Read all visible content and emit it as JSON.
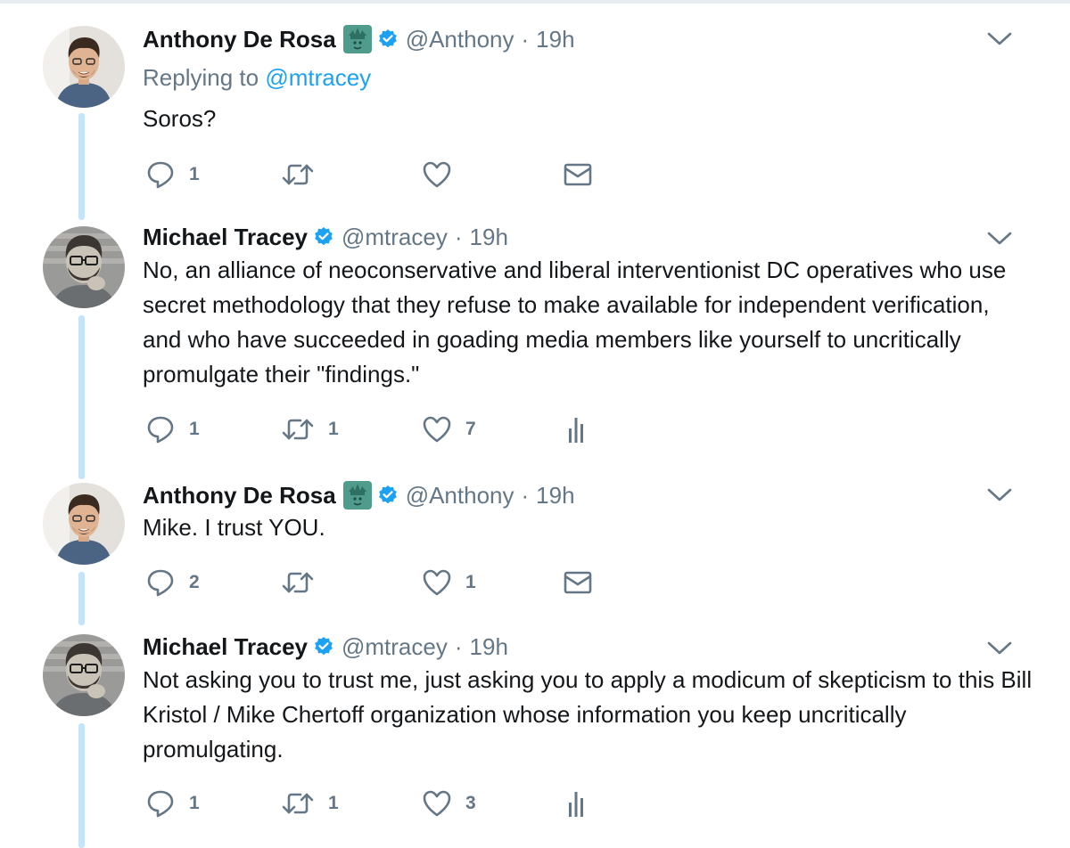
{
  "colors": {
    "accent": "#1da1f2",
    "muted": "#657786",
    "text": "#14171a",
    "thread": "#c4e4f9"
  },
  "tweets": [
    {
      "name": "Anthony De Rosa",
      "emoji": "statue-of-liberty",
      "verified": true,
      "handle": "@Anthony",
      "separator": "·",
      "time": "19h",
      "reply_prefix": "Replying to",
      "reply_mention": "@mtracey",
      "text": "Soros?",
      "replies": "1",
      "retweets": "",
      "likes": "",
      "extra_icon": "envelope-icon"
    },
    {
      "name": "Michael Tracey",
      "verified": true,
      "handle": "@mtracey",
      "separator": "·",
      "time": "19h",
      "text": "No, an alliance of neoconservative and liberal interventionist DC operatives who use secret methodology that they refuse to make available for independent verification, and who have succeeded in goading media members like yourself to uncritically promulgate their \"findings.\"",
      "replies": "1",
      "retweets": "1",
      "likes": "7",
      "extra_icon": "analytics-icon"
    },
    {
      "name": "Anthony De Rosa",
      "emoji": "statue-of-liberty",
      "verified": true,
      "handle": "@Anthony",
      "separator": "·",
      "time": "19h",
      "text": "Mike. I trust YOU.",
      "replies": "2",
      "retweets": "",
      "likes": "1",
      "extra_icon": "envelope-icon"
    },
    {
      "name": "Michael Tracey",
      "verified": true,
      "handle": "@mtracey",
      "separator": "·",
      "time": "19h",
      "text": "Not asking you to trust me, just asking you to apply a modicum of skepticism to this Bill Kristol / Mike Chertoff organization whose information you keep uncritically promulgating.",
      "replies": "1",
      "retweets": "1",
      "likes": "3",
      "extra_icon": "analytics-icon"
    }
  ]
}
